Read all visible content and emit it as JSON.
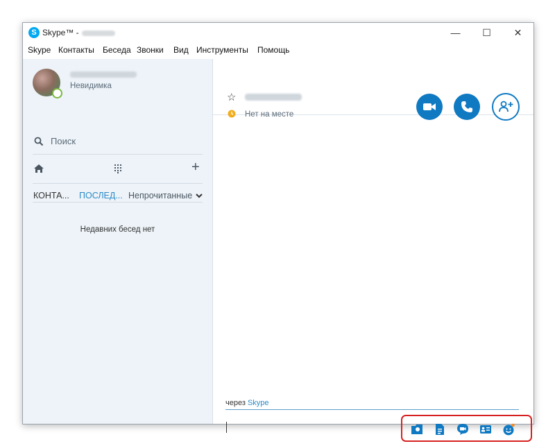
{
  "window": {
    "app_name": "Skype™ -",
    "controls": {
      "minimize": "—",
      "maximize": "☐",
      "close": "✕"
    }
  },
  "menu": [
    "Skype",
    "Контакты",
    "Беседа",
    "Звонки",
    "Вид",
    "Инструменты",
    "Помощь"
  ],
  "profile": {
    "status": "Невидимка",
    "presence_color": "#7bb73e"
  },
  "search": {
    "label": "Поиск"
  },
  "tabs": {
    "contacts": "КОНТА...",
    "recent": "ПОСЛЕД...",
    "unread": "Непрочитанные"
  },
  "recent_empty": "Недавних бесед нет",
  "chat": {
    "status": "Нет на месте",
    "via_prefix": "через",
    "via_link": "Skype"
  },
  "icons": {
    "app": "skype-logo-icon",
    "search": "search-icon",
    "home": "home-icon",
    "dialpad": "dialpad-icon",
    "add": "plus-icon",
    "favorite": "star-icon",
    "away": "clock-icon",
    "video": "video-camera-icon",
    "call": "phone-icon",
    "add_contact": "add-person-icon",
    "toolbar": [
      "send-image-icon",
      "send-file-icon",
      "video-message-icon",
      "send-contact-icon",
      "emoticon-icon"
    ]
  },
  "colors": {
    "accent": "#0f79c2",
    "link": "#2a8ac8",
    "away": "#f0ad1f",
    "highlight_border": "#d62020",
    "sidebar_bg": "#edf3f8"
  }
}
